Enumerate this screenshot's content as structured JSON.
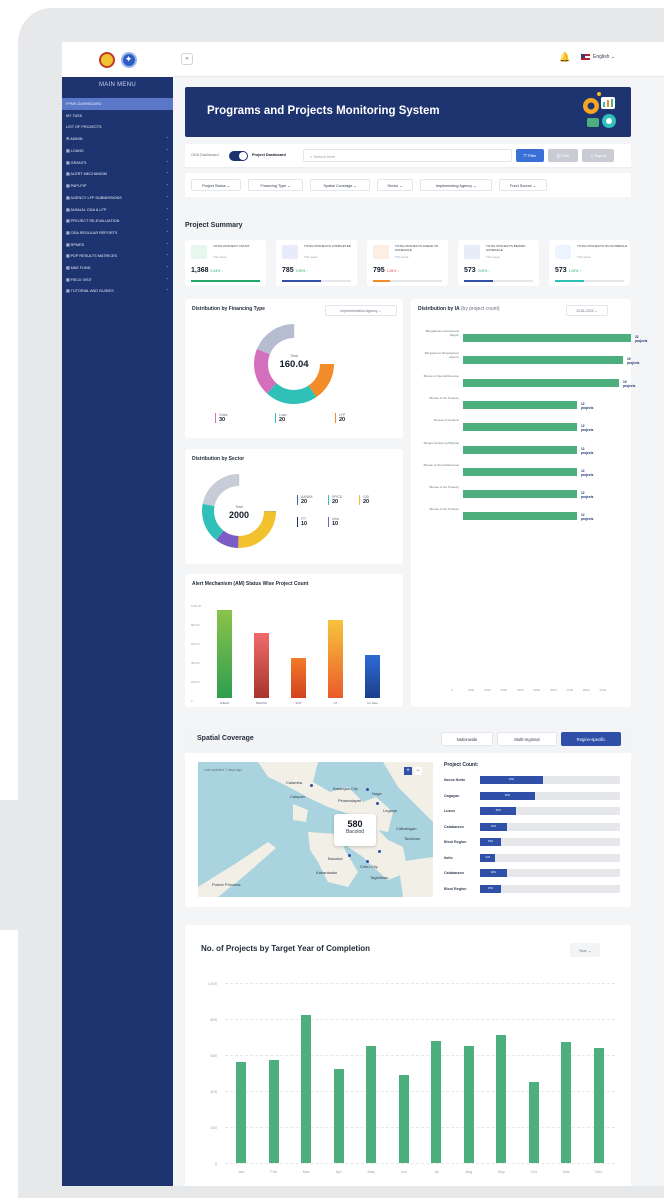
{
  "sidebar": {
    "menu_title": "MAIN MENU",
    "items": [
      {
        "label": "FPMS DASHBOARD",
        "active": true,
        "chev": false
      },
      {
        "label": "MY TASK",
        "chev": false
      },
      {
        "label": "LIST OF PROJECTS",
        "chev": false
      },
      {
        "label": "⚙ ADMIN",
        "chev": true
      },
      {
        "label": "▦ LOANS",
        "chev": true
      },
      {
        "label": "▦ GRANTS",
        "chev": true
      },
      {
        "label": "▦ ALERT MECHANISM",
        "chev": true
      },
      {
        "label": "▦ PAPI-PIP",
        "chev": true
      },
      {
        "label": "▦ AGENCY LFP SUBMISSIONS",
        "chev": true
      },
      {
        "label": "▦ ANNUAL ODA & LFP",
        "chev": true
      },
      {
        "label": "▦ PROJECT RE-EVALUATION",
        "chev": true
      },
      {
        "label": "▦ ODA REGULAR REPORTS",
        "chev": true
      },
      {
        "label": "▦ RPMES",
        "chev": true
      },
      {
        "label": "▦ PDP RESULTS MATRICES",
        "chev": true
      },
      {
        "label": "▦ M&E FUND",
        "chev": true
      },
      {
        "label": "▦ FIELD VISIT",
        "chev": true
      },
      {
        "label": "▦ TUTORIAL AND GUIDES",
        "chev": true
      }
    ]
  },
  "topbar": {
    "collapse_icon": "«",
    "language": "English ⌄"
  },
  "banner": {
    "title": "Programs and Projects Monitoring System"
  },
  "filterbar": {
    "oda_label": "ODA Dashboard",
    "project_label": "Project Dashboard",
    "search_placeholder": "Search here",
    "filter_label": "⛉ Filter",
    "print_label": "⎙ Print",
    "export_label": "⇩ Export"
  },
  "filters": [
    "Project Status ⌄",
    "Financing Type ⌄",
    "Spatial Coverage ⌄",
    "Sector ⌄",
    "Implementing Agency ⌄",
    "Fund Source ⌄"
  ],
  "summary": {
    "title": "Project Summary",
    "cards": [
      {
        "label": "TOTAL PROJECT COUNT",
        "sub": "This week",
        "value": "1,368",
        "change": "0.43% ↑",
        "color": "#22a86b",
        "icon_bg": "#e7f6ee",
        "fill": 1.0
      },
      {
        "label": "TOTAL PROJECTS COMPLETED",
        "sub": "This week",
        "value": "785",
        "change": "0.00% ↑",
        "color": "#22a86b",
        "icon_bg": "#e8ecf8",
        "fill": 0.57
      },
      {
        "label": "TOTAL PROJECTS AHEAD OF SCHEDULE",
        "sub": "This week",
        "value": "795",
        "change": "1.06% ↓",
        "color": "#e24b4b",
        "icon_bg": "#fdeee4",
        "fill": 0.24
      },
      {
        "label": "TOTAL PROJECTS BEHIND SCHEDULE",
        "sub": "This week",
        "value": "573",
        "change": "0.00% ↑",
        "color": "#22a86b",
        "icon_bg": "#e8ecf8",
        "fill": 0.42
      },
      {
        "label": "TOTAL PROJECTS ON SCHEDULE",
        "sub": "This week",
        "value": "573",
        "change": "1.00% ↑",
        "color": "#22a86b",
        "icon_bg": "#eef4ff",
        "fill": 0.42
      }
    ]
  },
  "financing": {
    "title": "Distribution by Financing Type",
    "select": "Implementation Agency ⌄",
    "center_label": "Total",
    "center_value": "160.04",
    "legend": [
      {
        "name": "Grant",
        "value": "30",
        "color": "#d36fbd"
      },
      {
        "name": "Loan",
        "value": "20",
        "color": "#2fc1b7"
      },
      {
        "name": "LFP",
        "value": "20",
        "color": "#f28c28"
      }
    ]
  },
  "sector": {
    "title": "Distribution by Sector",
    "center_label": "Total",
    "center_value": "2000",
    "legend": [
      {
        "name": "AANRA",
        "value": "20",
        "color": "#3a63c6"
      },
      {
        "name": "SPICE",
        "value": "20",
        "color": "#2fc1b7"
      },
      {
        "name": "GID",
        "value": "20",
        "color": "#f2c12e"
      },
      {
        "name": "ITT",
        "value": "10",
        "color": "#1e3470"
      },
      {
        "name": "Infra",
        "value": "10",
        "color": "#7b5cc4"
      }
    ]
  },
  "ia": {
    "title": "Distribution by IA",
    "title_sub": "(by project count)",
    "select": "2018-2024 ⌄",
    "rows": [
      {
        "label": "Bangsamoro Autonomous Region",
        "value": "22 projects",
        "frac": 0.84
      },
      {
        "label": "Bangsamoro Development Agency",
        "value": "19 projects",
        "frac": 0.8
      },
      {
        "label": "Bureau of Internal Revenue",
        "value": "19 projects",
        "frac": 0.78
      },
      {
        "label": "Bureau of the Treasury",
        "value": "12 projects",
        "frac": 0.57
      },
      {
        "label": "Bureau of Customs",
        "value": "12 projects",
        "frac": 0.57
      },
      {
        "label": "Bangko Sentral ng Pilipinas",
        "value": "12 projects",
        "frac": 0.57
      },
      {
        "label": "Bureau of Internal Revenue",
        "value": "12 projects",
        "frac": 0.57
      },
      {
        "label": "Bureau of the Treasury",
        "value": "12 projects",
        "frac": 0.57
      },
      {
        "label": "Bureau of the Treasury",
        "value": "12 projects",
        "frac": 0.57
      }
    ],
    "x_ticks": [
      "0",
      "1000",
      "2000",
      "3000",
      "4000",
      "5000",
      "6000",
      "7000",
      "8000",
      "9000"
    ]
  },
  "alert": {
    "title": "Alert Mechanism (AM) Status Wise Project Count",
    "y_ticks": [
      "1000.00",
      "800.00",
      "600.00",
      "400.00",
      "200.00",
      "0"
    ],
    "bars": [
      {
        "label": "AHEAD",
        "value": 930,
        "top": "#8bc34a",
        "bottom": "#2e9e4f"
      },
      {
        "label": "BEHIND",
        "value": 680,
        "top": "#f06b6b",
        "bottom": "#a8342c"
      },
      {
        "label": "SLIP",
        "value": 420,
        "top": "#f27a2a",
        "bottom": "#d2421f"
      },
      {
        "label": "OT",
        "value": 820,
        "top": "#f6c43c",
        "bottom": "#ec5a2a"
      },
      {
        "label": "No Data",
        "value": 450,
        "top": "#2e6bd6",
        "bottom": "#1b3f8a"
      }
    ]
  },
  "spatial": {
    "title": "Spatial Coverage",
    "tabs": [
      "Nationwide",
      "Multi-regional",
      "Region-specific"
    ],
    "map_updated": "Last updated: 7 days ago",
    "map_labels": [
      "Calamba",
      "Batangas City",
      "Calapan",
      "Pinamalayan",
      "Naga",
      "Legazpi",
      "Catbalogan",
      "Tacloban",
      "Bacolod",
      "Cebu City",
      "Kabankalan",
      "Tagbilaran",
      "Puerto Princesa"
    ],
    "popup_value": "580",
    "popup_label": "Bacolod",
    "count_title": "Project Count:",
    "counts": [
      {
        "label": "Ilocos Norte",
        "pct": "45%",
        "frac": 0.45
      },
      {
        "label": "Cagayan",
        "pct": "39%",
        "frac": 0.39
      },
      {
        "label": "Luzon",
        "pct": "26%",
        "frac": 0.26
      },
      {
        "label": "Calabarzon",
        "pct": "19%",
        "frac": 0.19
      },
      {
        "label": "Bicol Region",
        "pct": "15%",
        "frac": 0.15
      },
      {
        "label": "Iloilo",
        "pct": "11%",
        "frac": 0.11
      },
      {
        "label": "Calabarzon",
        "pct": "19%",
        "frac": 0.19
      },
      {
        "label": "Bicol Region",
        "pct": "15%",
        "frac": 0.15
      }
    ]
  },
  "target": {
    "title": "No. of Projects by Target Year of Completion",
    "select": "Year ⌄",
    "y_ticks": [
      "1,000",
      "800",
      "600",
      "400",
      "200",
      "0"
    ]
  },
  "chart_data": {
    "type": "bar",
    "title": "No. of Projects by Target Year of Completion",
    "categories": [
      "Jan",
      "Feb",
      "Mar",
      "Apr",
      "May",
      "Jun",
      "Jul",
      "Aug",
      "Sep",
      "Oct",
      "Nov",
      "Dec"
    ],
    "values": [
      560,
      570,
      820,
      520,
      650,
      490,
      680,
      650,
      710,
      450,
      670,
      640
    ],
    "ylim": [
      0,
      1000
    ],
    "grid": true
  }
}
